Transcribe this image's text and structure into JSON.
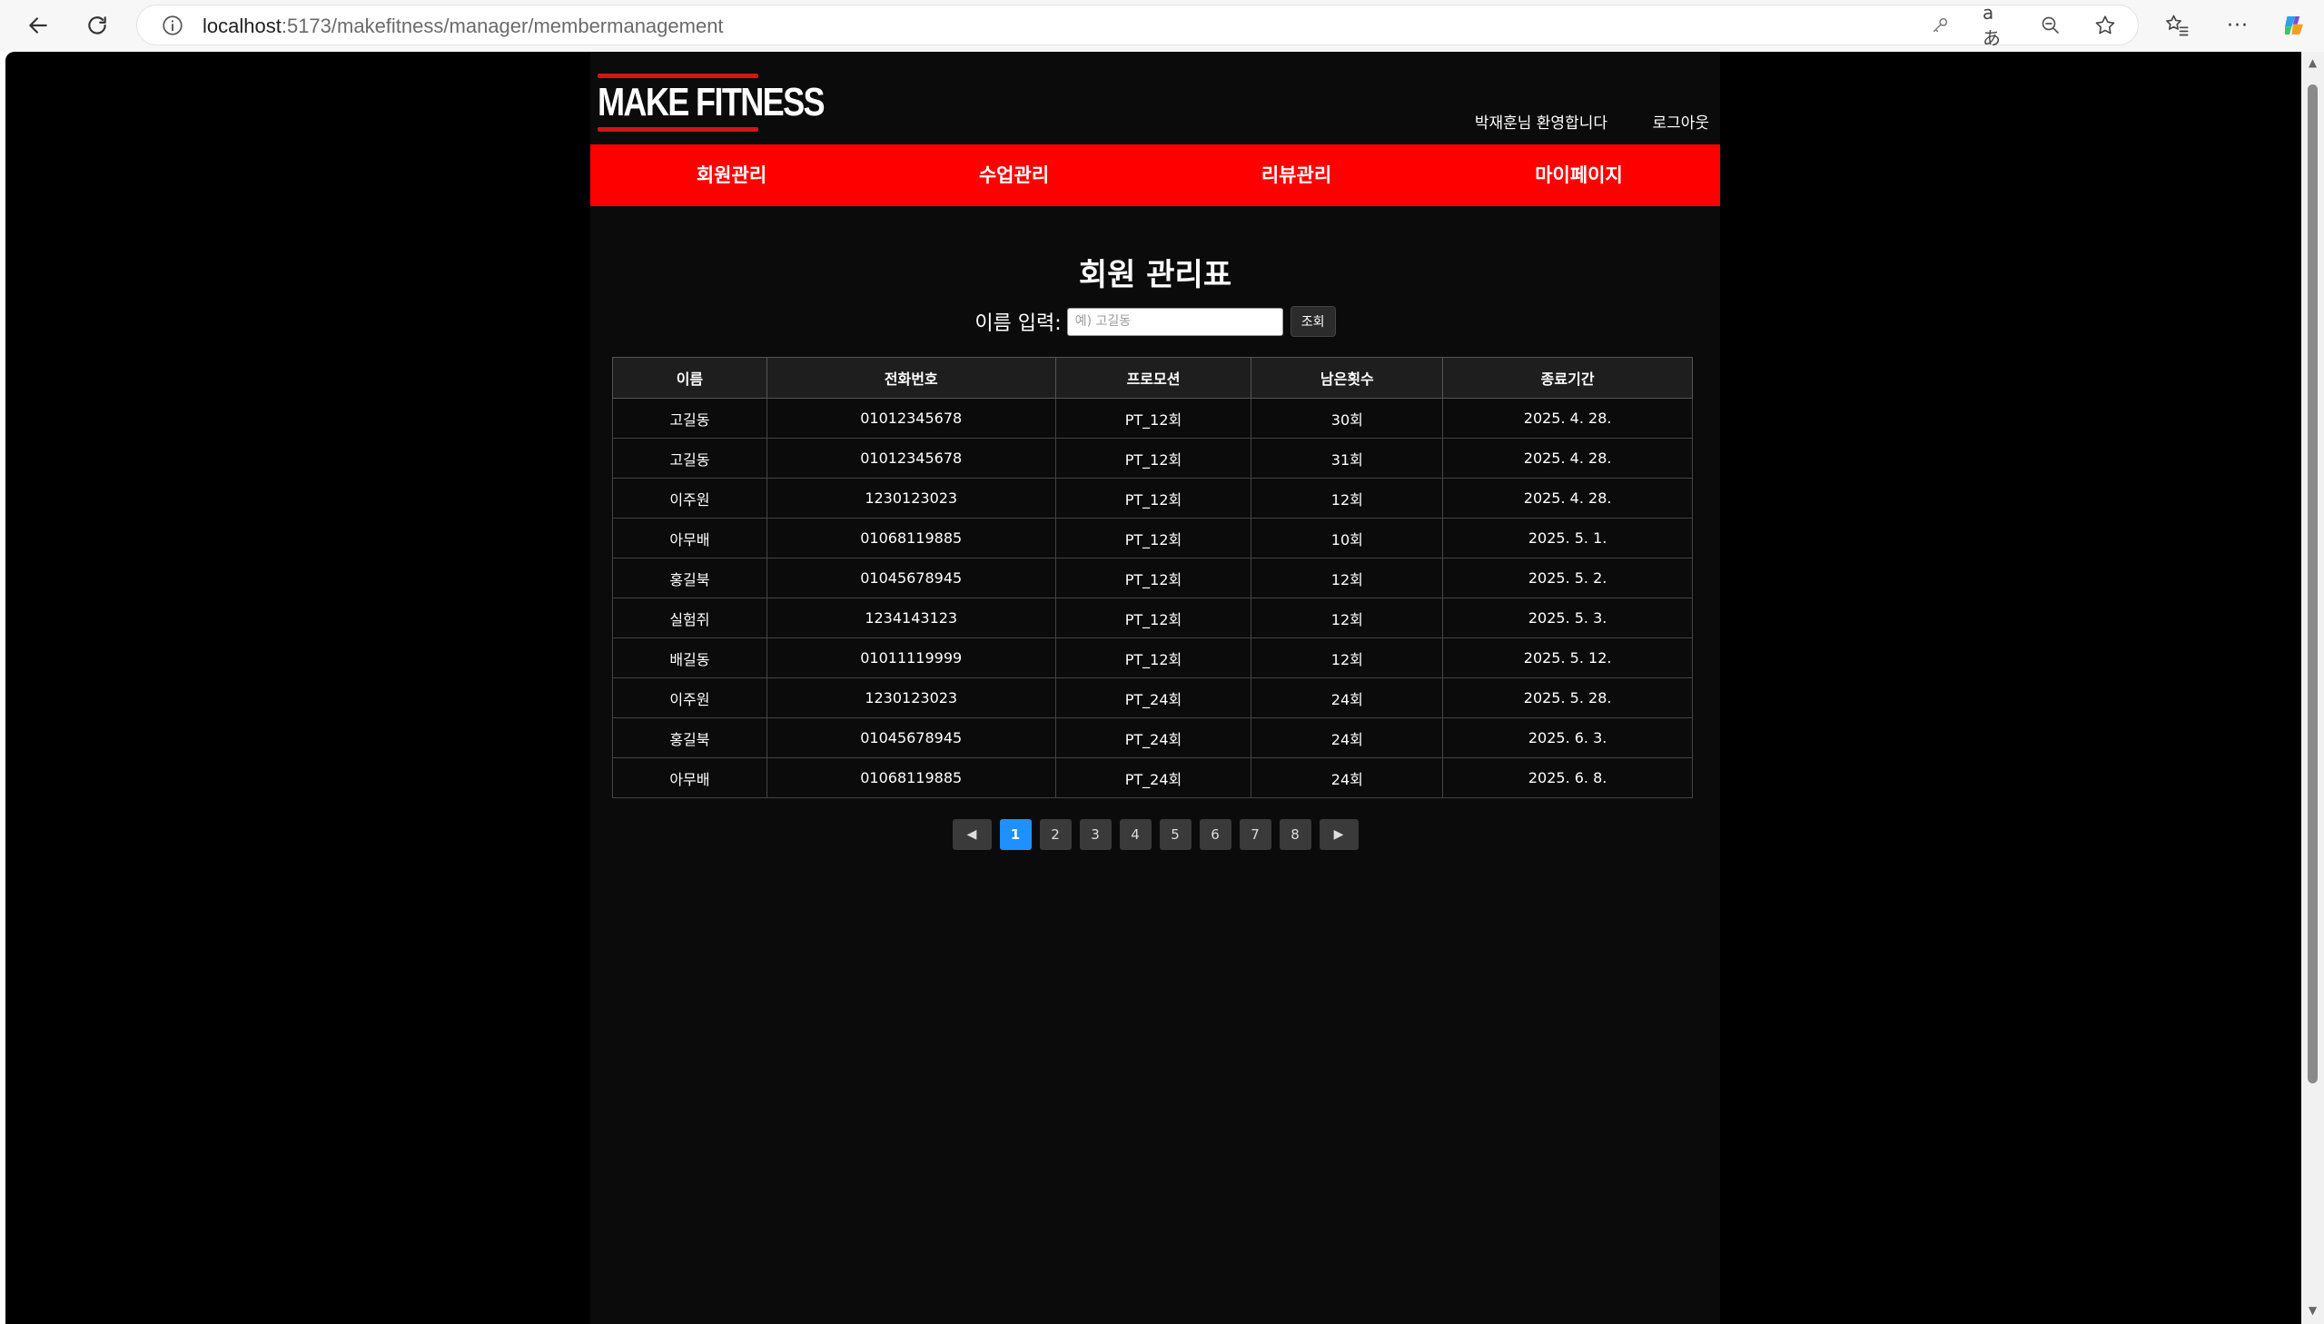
{
  "browser": {
    "url_host": "localhost",
    "url_path": ":5173/makefitness/manager/membermanagement"
  },
  "header": {
    "logo_text": "MAKE FITNESS",
    "welcome": "박재훈님 환영합니다",
    "logout": "로그아웃"
  },
  "menu": [
    {
      "label": "회원관리"
    },
    {
      "label": "수업관리"
    },
    {
      "label": "리뷰관리"
    },
    {
      "label": "마이페이지"
    }
  ],
  "page": {
    "title": "회원 관리표"
  },
  "search": {
    "label": "이름 입력:",
    "placeholder": "예) 고길동",
    "button": "조회"
  },
  "table": {
    "headers": [
      "이름",
      "전화번호",
      "프로모션",
      "남은횟수",
      "종료기간"
    ],
    "rows": [
      [
        "고길동",
        "01012345678",
        "PT_12회",
        "30회",
        "2025. 4. 28."
      ],
      [
        "고길동",
        "01012345678",
        "PT_12회",
        "31회",
        "2025. 4. 28."
      ],
      [
        "이주원",
        "1230123023",
        "PT_12회",
        "12회",
        "2025. 4. 28."
      ],
      [
        "아무배",
        "01068119885",
        "PT_12회",
        "10회",
        "2025. 5. 1."
      ],
      [
        "홍길북",
        "01045678945",
        "PT_12회",
        "12회",
        "2025. 5. 2."
      ],
      [
        "실험쥐",
        "1234143123",
        "PT_12회",
        "12회",
        "2025. 5. 3."
      ],
      [
        "배길동",
        "01011119999",
        "PT_12회",
        "12회",
        "2025. 5. 12."
      ],
      [
        "이주원",
        "1230123023",
        "PT_24회",
        "24회",
        "2025. 5. 28."
      ],
      [
        "홍길북",
        "01045678945",
        "PT_24회",
        "24회",
        "2025. 6. 3."
      ],
      [
        "아무배",
        "01068119885",
        "PT_24회",
        "24회",
        "2025. 6. 8."
      ]
    ]
  },
  "pagination": {
    "prev": "◀",
    "next": "▶",
    "pages": [
      "1",
      "2",
      "3",
      "4",
      "5",
      "6",
      "7",
      "8"
    ],
    "current": "1"
  },
  "colors": {
    "menu_bg": "#ff0000",
    "page_bg": "#000000",
    "active_page": "#1e90ff"
  }
}
